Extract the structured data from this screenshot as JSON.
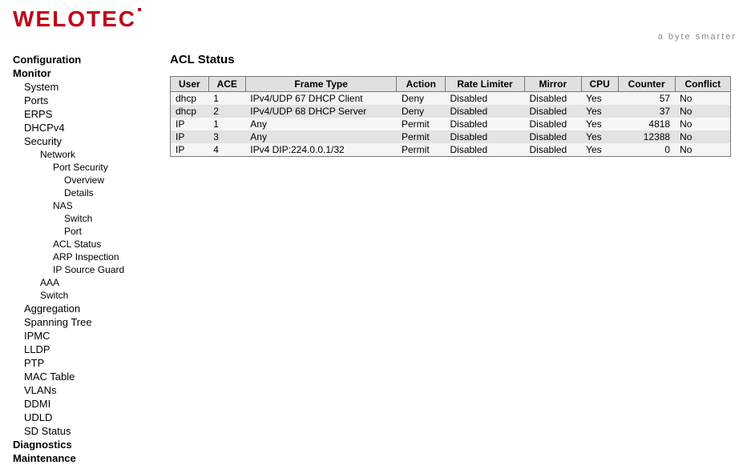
{
  "logo": {
    "text": "WELOTEC",
    "tagline": "a byte smarter"
  },
  "nav": {
    "groups": [
      {
        "label": "Configuration",
        "kind": "group"
      },
      {
        "label": "Monitor",
        "kind": "group"
      },
      {
        "label": "System",
        "kind": "item",
        "lvl": 1
      },
      {
        "label": "Ports",
        "kind": "item",
        "lvl": 1
      },
      {
        "label": "ERPS",
        "kind": "item",
        "lvl": 1
      },
      {
        "label": "DHCPv4",
        "kind": "item",
        "lvl": 1
      },
      {
        "label": "Security",
        "kind": "item",
        "lvl": 1
      },
      {
        "label": "Network",
        "kind": "item",
        "lvl": 2
      },
      {
        "label": "Port Security",
        "kind": "item",
        "lvl": 3
      },
      {
        "label": "Overview",
        "kind": "item",
        "lvl": 4
      },
      {
        "label": "Details",
        "kind": "item",
        "lvl": 4
      },
      {
        "label": "NAS",
        "kind": "item",
        "lvl": 3
      },
      {
        "label": "Switch",
        "kind": "item",
        "lvl": 4
      },
      {
        "label": "Port",
        "kind": "item",
        "lvl": 4
      },
      {
        "label": "ACL Status",
        "kind": "item",
        "lvl": 3
      },
      {
        "label": "ARP Inspection",
        "kind": "item",
        "lvl": 3
      },
      {
        "label": "IP Source Guard",
        "kind": "item",
        "lvl": 3
      },
      {
        "label": "AAA",
        "kind": "item",
        "lvl": 2
      },
      {
        "label": "Switch",
        "kind": "item",
        "lvl": 2
      },
      {
        "label": "Aggregation",
        "kind": "item",
        "lvl": 1
      },
      {
        "label": "Spanning Tree",
        "kind": "item",
        "lvl": 1
      },
      {
        "label": "IPMC",
        "kind": "item",
        "lvl": 1
      },
      {
        "label": "LLDP",
        "kind": "item",
        "lvl": 1
      },
      {
        "label": "PTP",
        "kind": "item",
        "lvl": 1
      },
      {
        "label": "MAC Table",
        "kind": "item",
        "lvl": 1
      },
      {
        "label": "VLANs",
        "kind": "item",
        "lvl": 1
      },
      {
        "label": "DDMI",
        "kind": "item",
        "lvl": 1
      },
      {
        "label": "UDLD",
        "kind": "item",
        "lvl": 1
      },
      {
        "label": "SD Status",
        "kind": "item",
        "lvl": 1
      },
      {
        "label": "Diagnostics",
        "kind": "group"
      },
      {
        "label": "Maintenance",
        "kind": "group"
      }
    ]
  },
  "page": {
    "title": "ACL Status"
  },
  "acl_table": {
    "columns": [
      "User",
      "ACE",
      "Frame Type",
      "Action",
      "Rate Limiter",
      "Mirror",
      "CPU",
      "Counter",
      "Conflict"
    ],
    "rows": [
      {
        "user": "dhcp",
        "ace": "1",
        "frame": "IPv4/UDP 67 DHCP Client",
        "action": "Deny",
        "rate": "Disabled",
        "mirror": "Disabled",
        "cpu": "Yes",
        "counter": "57",
        "conflict": "No"
      },
      {
        "user": "dhcp",
        "ace": "2",
        "frame": "IPv4/UDP 68 DHCP Server",
        "action": "Deny",
        "rate": "Disabled",
        "mirror": "Disabled",
        "cpu": "Yes",
        "counter": "37",
        "conflict": "No"
      },
      {
        "user": "IP",
        "ace": "1",
        "frame": "Any",
        "action": "Permit",
        "rate": "Disabled",
        "mirror": "Disabled",
        "cpu": "Yes",
        "counter": "4818",
        "conflict": "No"
      },
      {
        "user": "IP",
        "ace": "3",
        "frame": "Any",
        "action": "Permit",
        "rate": "Disabled",
        "mirror": "Disabled",
        "cpu": "Yes",
        "counter": "12388",
        "conflict": "No"
      },
      {
        "user": "IP",
        "ace": "4",
        "frame": "IPv4 DIP:224.0.0.1/32",
        "action": "Permit",
        "rate": "Disabled",
        "mirror": "Disabled",
        "cpu": "Yes",
        "counter": "0",
        "conflict": "No"
      }
    ]
  }
}
